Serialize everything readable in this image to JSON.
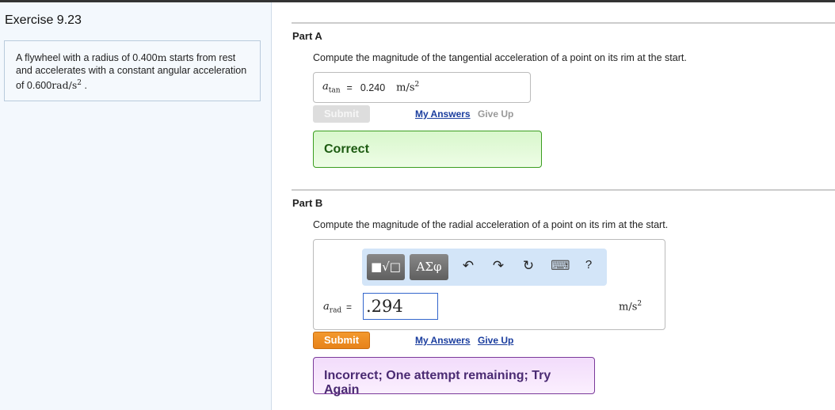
{
  "left": {
    "title": "Exercise 9.23",
    "problem": {
      "text1": "A flywheel with a radius of 0.400",
      "unit1": "m",
      "text2": " starts from rest and accelerates with a constant angular acceleration of 0.600",
      "unit2": "rad/s",
      "exp": "2",
      "text3": " ."
    }
  },
  "partA": {
    "title": "Part A",
    "question": "Compute the magnitude of the tangential acceleration of a point on its rim at the start.",
    "var": "a",
    "sub": "tan",
    "eq": "=",
    "value": "0.240",
    "unit": "m/s",
    "exp": "2",
    "submit": "Submit",
    "my_answers": "My Answers",
    "give_up": "Give Up",
    "feedback": "Correct"
  },
  "partB": {
    "title": "Part B",
    "question": "Compute the magnitude of the radial acceleration of a point on its rim at the start.",
    "toolbar": {
      "templates": "■√□",
      "symbols": "ΑΣφ",
      "undo": "↶",
      "redo": "↷",
      "reset": "↻",
      "keyboard": "⌨",
      "help": "?"
    },
    "var": "a",
    "sub": "rad",
    "eq": "=",
    "value": ".294",
    "unit": "m/s",
    "exp": "2",
    "submit": "Submit",
    "my_answers": "My Answers",
    "give_up": "Give Up",
    "feedback": "Incorrect; One attempt remaining; Try Again"
  },
  "colors": {
    "submit": "#e7821a",
    "correct_border": "#3a9d1f",
    "incorrect_border": "#7a3a9a",
    "link": "#1a3d9e"
  }
}
